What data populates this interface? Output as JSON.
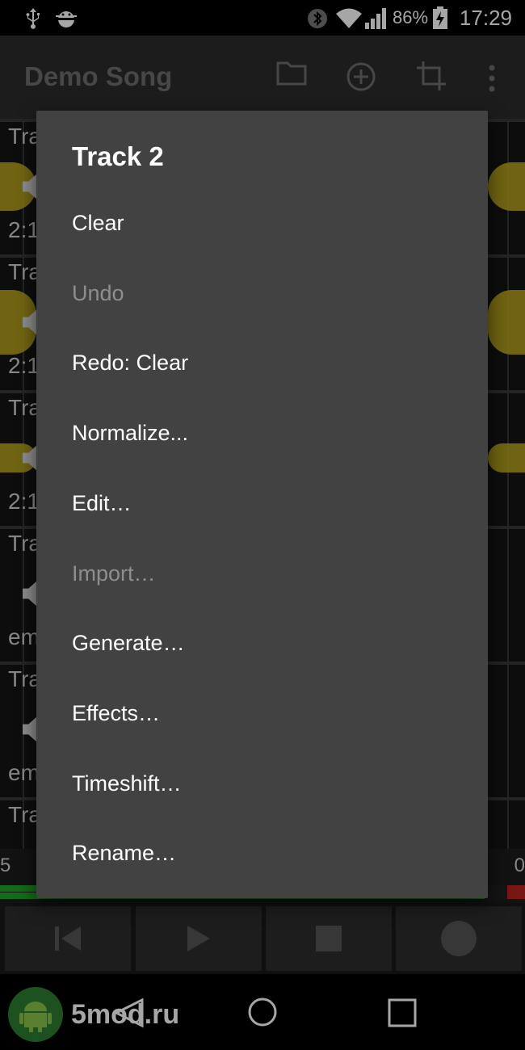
{
  "status_bar": {
    "battery_percent": "86%",
    "time": "17:29",
    "icons": [
      "usb-icon",
      "android-debug-icon",
      "bluetooth-icon",
      "wifi-icon",
      "signal-icon",
      "battery-charging-icon"
    ]
  },
  "app_bar": {
    "title": "Demo Song",
    "actions": [
      "folder-icon",
      "add-circle-icon",
      "crop-icon",
      "more-vert-icon"
    ]
  },
  "tracks": [
    {
      "name": "Tra",
      "time": "2:1"
    },
    {
      "name": "Tra",
      "time": "2:1"
    },
    {
      "name": "Tra",
      "time": "2:1"
    },
    {
      "name": "Tra",
      "time": "em"
    },
    {
      "name": "Tra",
      "time": "em"
    },
    {
      "name": "Tra",
      "time": ""
    }
  ],
  "ruler": {
    "left": "5",
    "right": "0"
  },
  "transport": [
    "skip-to-start-icon",
    "play-icon",
    "stop-icon",
    "record-icon"
  ],
  "menu": {
    "title": "Track 2",
    "items": [
      {
        "label": "Clear",
        "enabled": true
      },
      {
        "label": "Undo",
        "enabled": false
      },
      {
        "label": "Redo: Clear",
        "enabled": true
      },
      {
        "label": "Normalize...",
        "enabled": true
      },
      {
        "label": "Edit…",
        "enabled": true
      },
      {
        "label": "Import…",
        "enabled": false
      },
      {
        "label": "Generate…",
        "enabled": true
      },
      {
        "label": "Effects…",
        "enabled": true
      },
      {
        "label": "Timeshift…",
        "enabled": true
      },
      {
        "label": "Rename…",
        "enabled": true
      }
    ]
  },
  "watermark": {
    "text": "5mod.ru"
  },
  "colors": {
    "dialog": "#424242",
    "waveform": "#c7b21e",
    "level_green": "#1fa52a",
    "level_red": "#b7231c"
  }
}
